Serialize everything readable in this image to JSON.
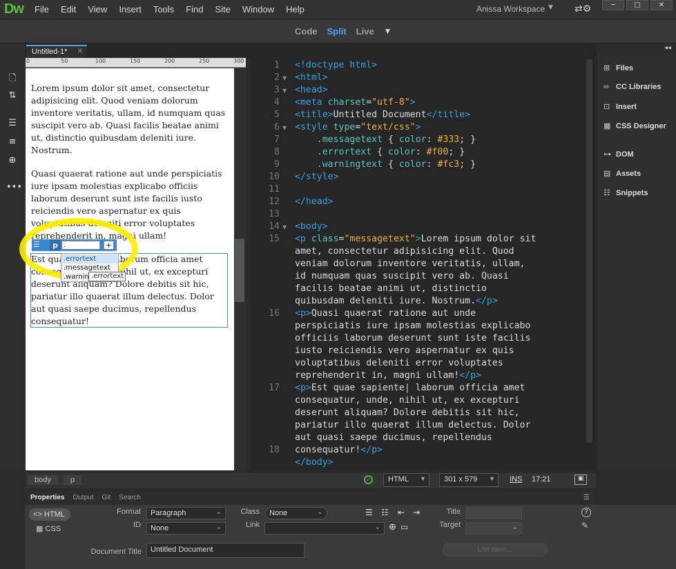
{
  "app": {
    "logo": "Dw",
    "workspace": "Anissa Workspace"
  },
  "menu": [
    "File",
    "Edit",
    "View",
    "Insert",
    "Tools",
    "Find",
    "Site",
    "Window",
    "Help"
  ],
  "views": {
    "code": "Code",
    "split": "Split",
    "live": "Live"
  },
  "document": {
    "tab": "Untitled-1*"
  },
  "ruler": [
    "0",
    "50",
    "100",
    "150",
    "200",
    "250",
    "300"
  ],
  "design": {
    "p1": "Lorem ipsum dolor sit amet, consectetur adipisicing elit. Quod veniam dolorum inventore veritatis, ullam, id numquam quas suscipit vero ab. Quasi facilis beatae animi ut, distinctio quibusdam deleniti iure. Nostrum.",
    "p2": "Quasi quaerat ratione aut unde perspiciatis iure ipsam molestias explicabo officiis laborum deserunt sunt iste facilis iusto reiciendis vero aspernatur ex quis voluptatibus deleniti error voluptates reprehenderit in, magni ullam!",
    "p3": "Est quae sapiente laborum officia amet consequatur, unde, nihil ut, ex excepturi deserunt aliquam? Dolore debitis sit hic, pariatur illo quaerat illum delectus. Dolor aut quasi saepe ducimus, repellendus consequatur!",
    "tag": "p",
    "class_input": ".",
    "hints": [
      ".errortext",
      ".messagetext",
      ".warnin"
    ],
    "tooltip": ".errortext"
  },
  "code": {
    "line_numbers": [
      "1",
      "2",
      "3",
      "4",
      "5",
      "6",
      "7",
      "8",
      "9",
      "10",
      "11",
      "12",
      "13",
      "14",
      "15",
      "",
      "",
      "",
      "",
      "",
      "16",
      "",
      "",
      "",
      "",
      "",
      "17",
      "",
      "",
      "",
      "",
      "18"
    ]
  },
  "right_panel": [
    "Files",
    "CC Libraries",
    "Insert",
    "CSS Designer",
    "DOM",
    "Assets",
    "Snippets"
  ],
  "status": {
    "crumbs": [
      "body",
      "p"
    ],
    "doctype": "HTML",
    "size": "301 x 579",
    "mode": "INS",
    "position": "17:21"
  },
  "properties": {
    "tabs": [
      "Properties",
      "Output",
      "Git",
      "Search"
    ],
    "html_btn": "HTML",
    "css_btn": "CSS",
    "format_label": "Format",
    "format_value": "Paragraph",
    "id_label": "ID",
    "id_value": "None",
    "class_label": "Class",
    "class_value": "None",
    "link_label": "Link",
    "title_label": "Title",
    "target_label": "Target",
    "doc_title_label": "Document Title",
    "doc_title_value": "Untitled Document",
    "list_item": "List Item..."
  }
}
